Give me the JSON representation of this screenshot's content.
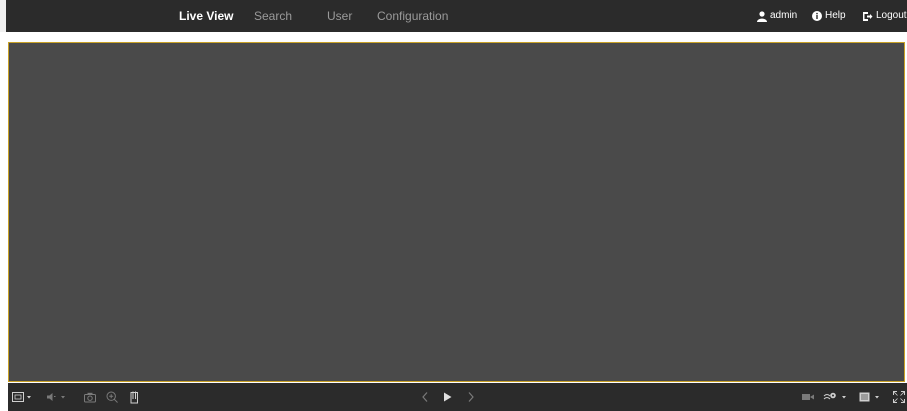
{
  "nav": {
    "items": [
      {
        "label": "Live View",
        "active": true
      },
      {
        "label": "Search",
        "active": false
      },
      {
        "label": "User",
        "active": false
      },
      {
        "label": "Configuration",
        "active": false
      }
    ]
  },
  "user_menu": {
    "username": "admin",
    "help_label": "Help",
    "logout_label": "Logout"
  },
  "icons": {
    "user": "user-icon",
    "help": "info-circle-icon",
    "logout": "logout-icon",
    "window_split": "window-split-icon",
    "volume": "volume-icon",
    "capture": "camera-icon",
    "zoom": "zoom-icon",
    "record_clip": "clip-icon",
    "prev": "chevron-left-icon",
    "play": "play-icon",
    "next": "chevron-right-icon",
    "record": "video-record-icon",
    "stream": "stream-settings-icon",
    "layout": "layout-icon",
    "fullscreen": "fullscreen-icon"
  },
  "colors": {
    "topbar_bg": "#2b2b2b",
    "video_bg": "#4a4a4a",
    "video_border": "#c9a227",
    "inactive_text": "#9a9a9a",
    "active_text": "#ffffff"
  }
}
